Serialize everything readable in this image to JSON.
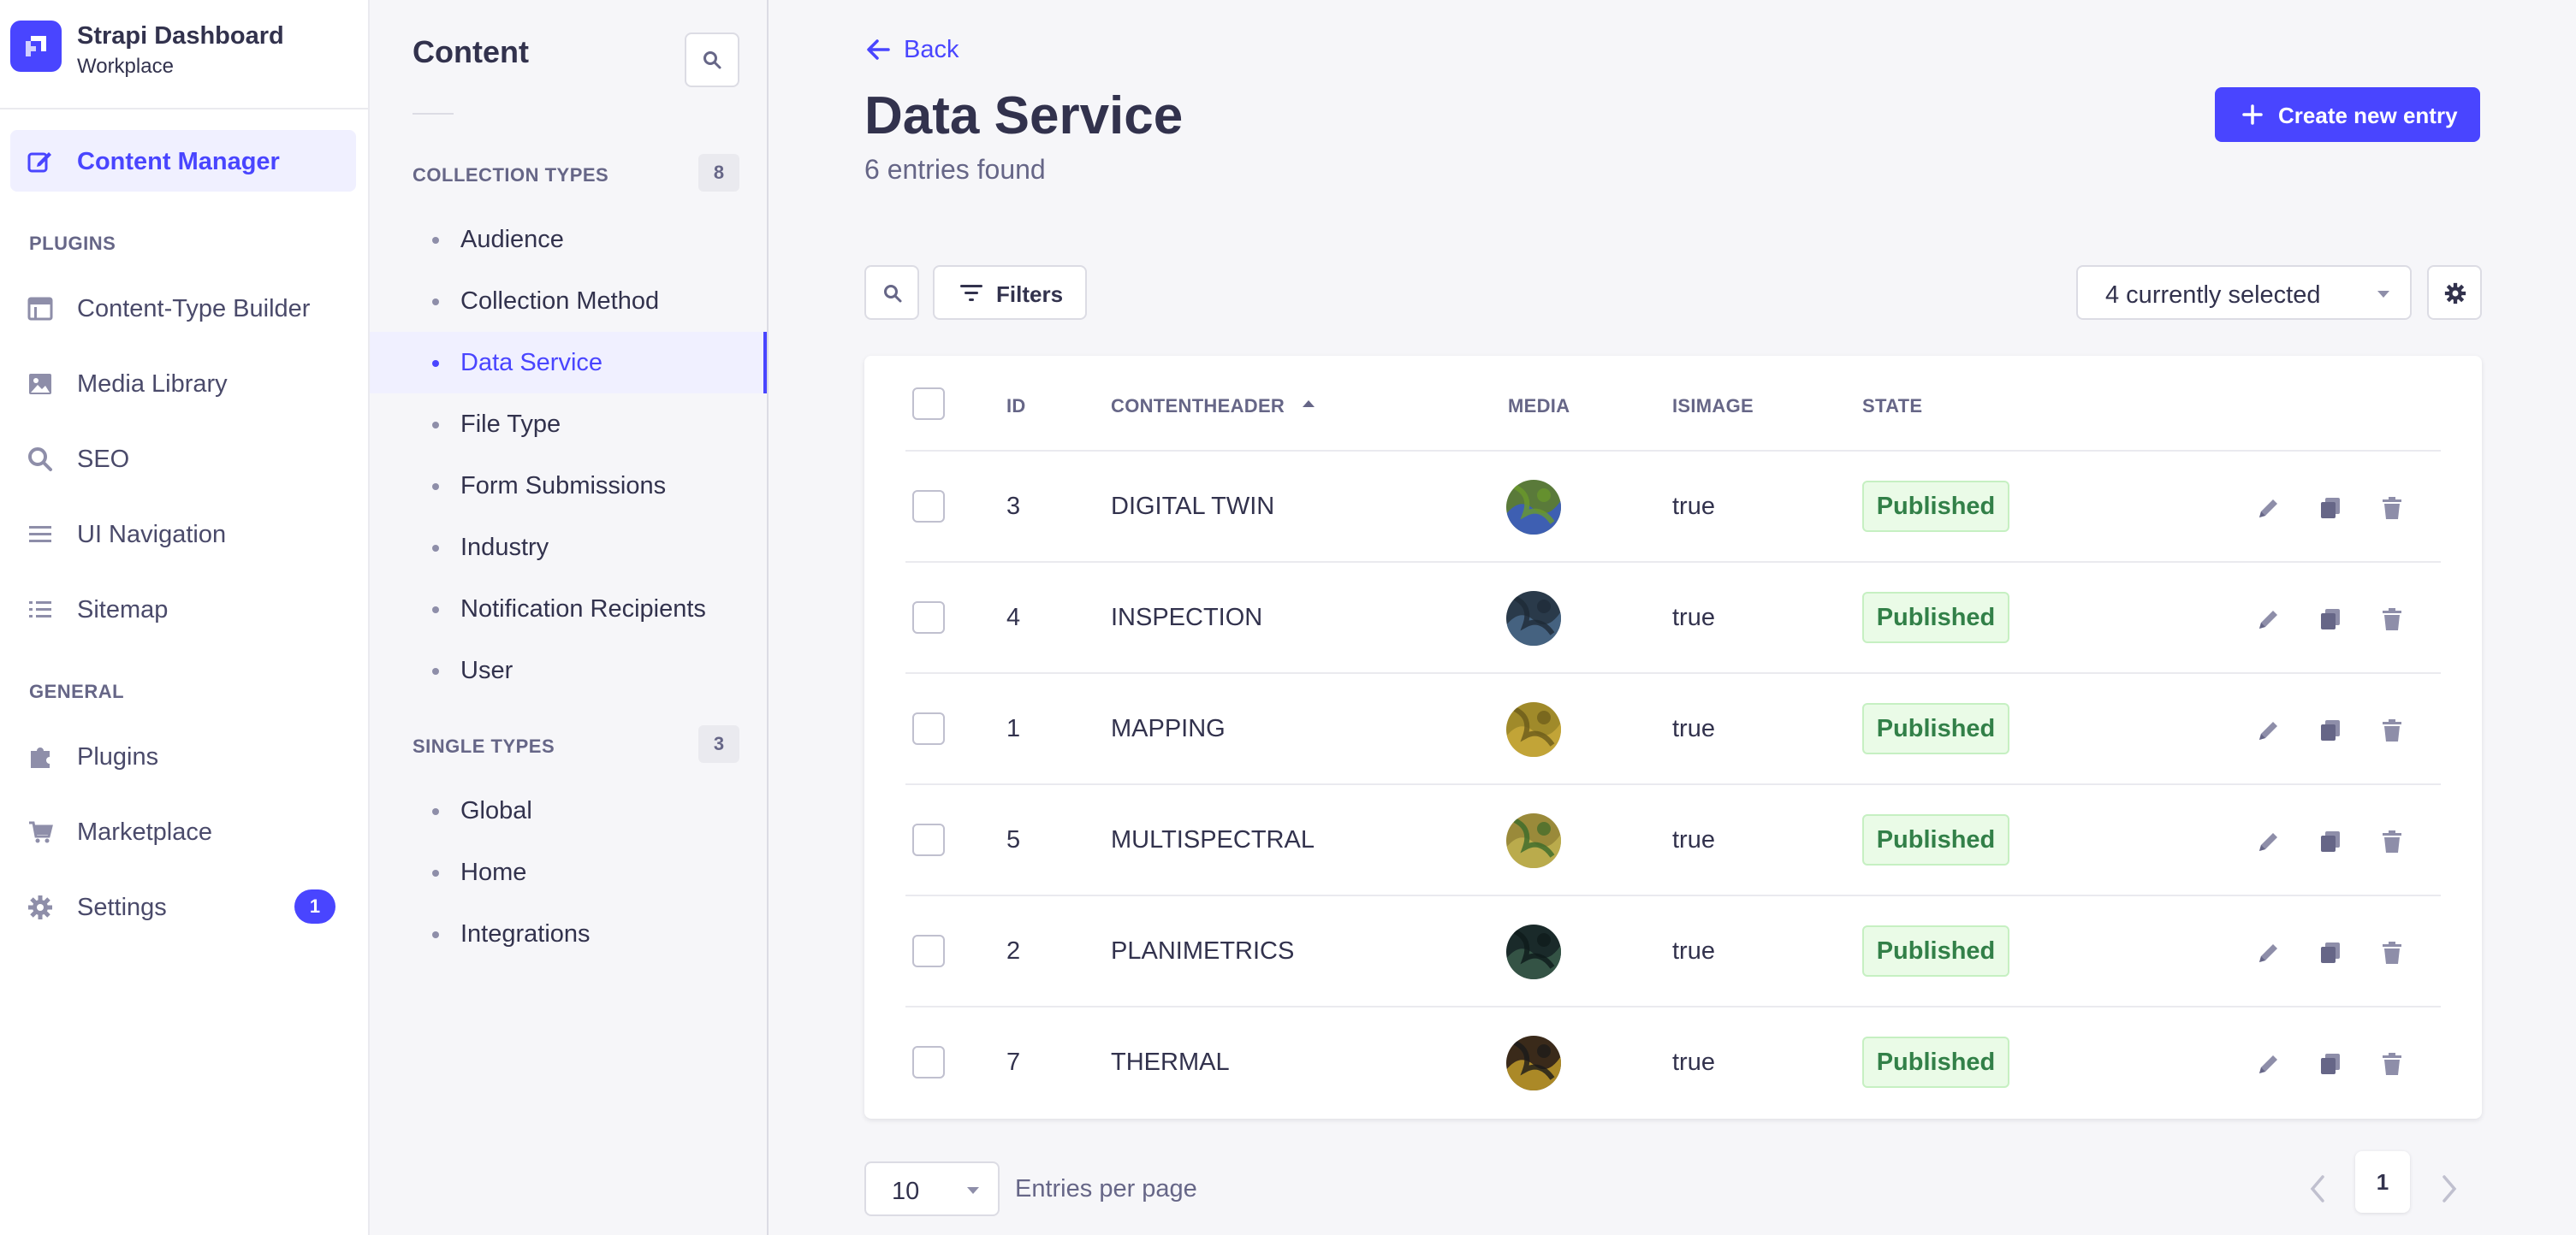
{
  "brand": {
    "title": "Strapi Dashboard",
    "subtitle": "Workplace"
  },
  "main_nav": {
    "top_item": {
      "label": "Content Manager",
      "icon": "pencil-square-icon"
    },
    "plugins_header": "PLUGINS",
    "plugins": [
      {
        "label": "Content-Type Builder",
        "icon": "layout-icon"
      },
      {
        "label": "Media Library",
        "icon": "image-icon"
      },
      {
        "label": "SEO",
        "icon": "search-icon"
      },
      {
        "label": "UI Navigation",
        "icon": "hamburger-icon"
      },
      {
        "label": "Sitemap",
        "icon": "list-icon"
      }
    ],
    "general_header": "GENERAL",
    "general": [
      {
        "label": "Plugins",
        "icon": "puzzle-icon"
      },
      {
        "label": "Marketplace",
        "icon": "cart-icon"
      },
      {
        "label": "Settings",
        "icon": "gear-icon",
        "badge": "1"
      }
    ]
  },
  "sub_nav": {
    "title": "Content",
    "collection_header": "COLLECTION TYPES",
    "collection_count": "8",
    "collection_types": [
      "Audience",
      "Collection Method",
      "Data Service",
      "File Type",
      "Form Submissions",
      "Industry",
      "Notification Recipients",
      "User"
    ],
    "active_item": "Data Service",
    "single_header": "SINGLE TYPES",
    "single_count": "3",
    "single_types": [
      "Global",
      "Home",
      "Integrations"
    ]
  },
  "main": {
    "back_label": "Back",
    "title": "Data Service",
    "entries_found": "6 entries found",
    "create_label": "Create new entry",
    "filters_label": "Filters",
    "columns_selected": "4 currently selected",
    "table": {
      "headers": {
        "id": "ID",
        "contentheader": "CONTENTHEADER",
        "media": "MEDIA",
        "isimage": "ISIMAGE",
        "state": "STATE"
      },
      "sort": "ascending",
      "rows": [
        {
          "id": "3",
          "contentheader": "DIGITAL TWIN",
          "isimage": "true",
          "state": "Published",
          "thumb": [
            "#5a7a3a",
            "#3a5ac8",
            "#6a9a2a"
          ]
        },
        {
          "id": "4",
          "contentheader": "INSPECTION",
          "isimage": "true",
          "state": "Published",
          "thumb": [
            "#2a3a4a",
            "#4a6a8a",
            "#1e2a36"
          ]
        },
        {
          "id": "1",
          "contentheader": "MAPPING",
          "isimage": "true",
          "state": "Published",
          "thumb": [
            "#a08a2a",
            "#c8a83a",
            "#6a5a1a"
          ]
        },
        {
          "id": "5",
          "contentheader": "MULTISPECTRAL",
          "isimage": "true",
          "state": "Published",
          "thumb": [
            "#9a8a3a",
            "#c0b050",
            "#3a6a2a"
          ]
        },
        {
          "id": "2",
          "contentheader": "PLANIMETRICS",
          "isimage": "true",
          "state": "Published",
          "thumb": [
            "#1a2a2a",
            "#3a5a4a",
            "#0e1a1a"
          ]
        },
        {
          "id": "7",
          "contentheader": "THERMAL",
          "isimage": "true",
          "state": "Published",
          "thumb": [
            "#3a2a1a",
            "#c09a2a",
            "#1a1a1a"
          ]
        }
      ]
    },
    "per_page": "10",
    "per_page_label": "Entries per page",
    "current_page": "1"
  },
  "colors": {
    "accent": "#4945ff",
    "published_text": "#328048",
    "published_bg": "#eafbe7"
  }
}
